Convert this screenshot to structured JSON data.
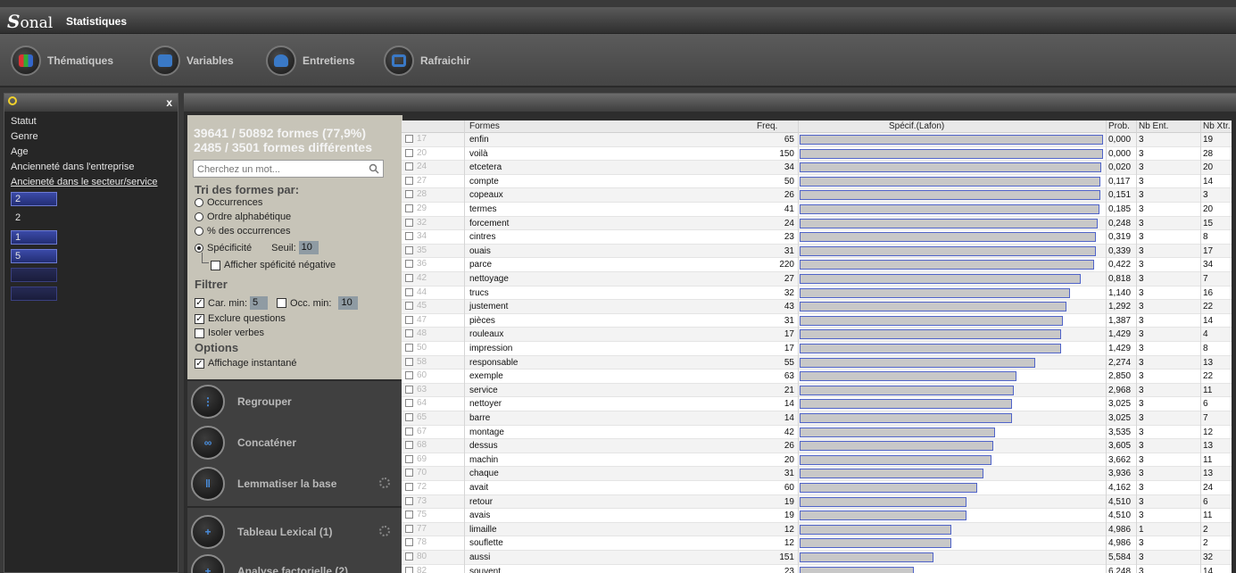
{
  "app": {
    "logo": "Sonal",
    "title": "Statistiques"
  },
  "toolbar": [
    {
      "label": "Thématiques",
      "icon": "grid-icon"
    },
    {
      "label": "Variables",
      "icon": "list-icon"
    },
    {
      "label": "Entretiens",
      "icon": "person-icon"
    },
    {
      "label": "Rafraichir",
      "icon": "refresh-icon"
    }
  ],
  "left_panel": {
    "close": "x",
    "variables": [
      "Statut",
      "Genre",
      "Age",
      "Ancienneté dans l'entreprise",
      "Ancieneté dans le secteur/service"
    ],
    "modalities": [
      "2",
      "2",
      "1",
      "5",
      "",
      ""
    ]
  },
  "stats": {
    "line1": "39641 / 50892 formes (77,9%)",
    "line2": "2485 / 3501 formes différentes"
  },
  "search": {
    "placeholder": "Cherchez un mot..."
  },
  "tri": {
    "title": "Tri des formes par:",
    "options": [
      "Occurrences",
      "Ordre alphabétique",
      "% des occurrences",
      "Spécificité"
    ],
    "selected": 3,
    "seuil_label": "Seuil:",
    "seuil_value": "10",
    "neg_label": "Afficher spéficité négative"
  },
  "filtrer": {
    "title": "Filtrer",
    "car_label": "Car. min:",
    "car_value": "5",
    "occ_label": "Occ. min:",
    "occ_value": "10",
    "exclure": "Exclure questions",
    "isoler": "Isoler verbes"
  },
  "options": {
    "title": "Options",
    "affichage": "Affichage instantané"
  },
  "actions": [
    {
      "label": "Regrouper",
      "glyph": "⋮"
    },
    {
      "label": "Concaténer",
      "glyph": "∞"
    },
    {
      "label": "Lemmatiser la base",
      "glyph": "‖"
    },
    {
      "label": "Tableau Lexical (1)",
      "glyph": "+"
    },
    {
      "label": "Analyse factorielle (2)",
      "glyph": "+"
    }
  ],
  "table": {
    "headers": {
      "formes": "Formes",
      "freq": "Freq.",
      "specif": "Spécif.(Lafon)",
      "prob": "Prob.",
      "nbent": "Nb Ent.",
      "nbxtr": "Nb Xtr."
    },
    "rows": [
      {
        "n": "17",
        "forme": "enfin",
        "freq": "65",
        "specif": 1.0,
        "prob": "0,000",
        "ent": "3",
        "xtr": "19"
      },
      {
        "n": "20",
        "forme": "voilà",
        "freq": "150",
        "specif": 1.0,
        "prob": "0,000",
        "ent": "3",
        "xtr": "28"
      },
      {
        "n": "24",
        "forme": "etcetera",
        "freq": "34",
        "specif": 0.995,
        "prob": "0,020",
        "ent": "3",
        "xtr": "20"
      },
      {
        "n": "27",
        "forme": "compte",
        "freq": "50",
        "specif": 0.99,
        "prob": "0,117",
        "ent": "3",
        "xtr": "14"
      },
      {
        "n": "28",
        "forme": "copeaux",
        "freq": "26",
        "specif": 0.99,
        "prob": "0,151",
        "ent": "3",
        "xtr": "3"
      },
      {
        "n": "29",
        "forme": "termes",
        "freq": "41",
        "specif": 0.987,
        "prob": "0,185",
        "ent": "3",
        "xtr": "20"
      },
      {
        "n": "32",
        "forme": "forcement",
        "freq": "24",
        "specif": 0.982,
        "prob": "0,248",
        "ent": "3",
        "xtr": "15"
      },
      {
        "n": "34",
        "forme": "cintres",
        "freq": "23",
        "specif": 0.976,
        "prob": "0,319",
        "ent": "3",
        "xtr": "8"
      },
      {
        "n": "35",
        "forme": "ouais",
        "freq": "31",
        "specif": 0.976,
        "prob": "0,339",
        "ent": "3",
        "xtr": "17"
      },
      {
        "n": "36",
        "forme": "parce",
        "freq": "220",
        "specif": 0.97,
        "prob": "0,422",
        "ent": "3",
        "xtr": "34"
      },
      {
        "n": "42",
        "forme": "nettoyage",
        "freq": "27",
        "specif": 0.925,
        "prob": "0,818",
        "ent": "3",
        "xtr": "7"
      },
      {
        "n": "44",
        "forme": "trucs",
        "freq": "32",
        "specif": 0.89,
        "prob": "1,140",
        "ent": "3",
        "xtr": "16"
      },
      {
        "n": "45",
        "forme": "justement",
        "freq": "43",
        "specif": 0.878,
        "prob": "1,292",
        "ent": "3",
        "xtr": "22"
      },
      {
        "n": "47",
        "forme": "pièces",
        "freq": "31",
        "specif": 0.868,
        "prob": "1,387",
        "ent": "3",
        "xtr": "14"
      },
      {
        "n": "48",
        "forme": "rouleaux",
        "freq": "17",
        "specif": 0.862,
        "prob": "1,429",
        "ent": "3",
        "xtr": "4"
      },
      {
        "n": "50",
        "forme": "impression",
        "freq": "17",
        "specif": 0.862,
        "prob": "1,429",
        "ent": "3",
        "xtr": "8"
      },
      {
        "n": "58",
        "forme": "responsable",
        "freq": "55",
        "specif": 0.777,
        "prob": "2,274",
        "ent": "3",
        "xtr": "13"
      },
      {
        "n": "60",
        "forme": "exemple",
        "freq": "63",
        "specif": 0.715,
        "prob": "2,850",
        "ent": "3",
        "xtr": "22"
      },
      {
        "n": "63",
        "forme": "service",
        "freq": "21",
        "specif": 0.705,
        "prob": "2,968",
        "ent": "3",
        "xtr": "11"
      },
      {
        "n": "64",
        "forme": "nettoyer",
        "freq": "14",
        "specif": 0.7,
        "prob": "3,025",
        "ent": "3",
        "xtr": "6"
      },
      {
        "n": "65",
        "forme": "barre",
        "freq": "14",
        "specif": 0.7,
        "prob": "3,025",
        "ent": "3",
        "xtr": "7"
      },
      {
        "n": "67",
        "forme": "montage",
        "freq": "42",
        "specif": 0.645,
        "prob": "3,535",
        "ent": "3",
        "xtr": "12"
      },
      {
        "n": "68",
        "forme": "dessus",
        "freq": "26",
        "specif": 0.637,
        "prob": "3,605",
        "ent": "3",
        "xtr": "13"
      },
      {
        "n": "69",
        "forme": "machin",
        "freq": "20",
        "specif": 0.632,
        "prob": "3,662",
        "ent": "3",
        "xtr": "11"
      },
      {
        "n": "70",
        "forme": "chaque",
        "freq": "31",
        "specif": 0.605,
        "prob": "3,936",
        "ent": "3",
        "xtr": "13"
      },
      {
        "n": "72",
        "forme": "avait",
        "freq": "60",
        "specif": 0.584,
        "prob": "4,162",
        "ent": "3",
        "xtr": "24"
      },
      {
        "n": "73",
        "forme": "retour",
        "freq": "19",
        "specif": 0.55,
        "prob": "4,510",
        "ent": "3",
        "xtr": "6"
      },
      {
        "n": "75",
        "forme": "avais",
        "freq": "19",
        "specif": 0.55,
        "prob": "4,510",
        "ent": "3",
        "xtr": "11"
      },
      {
        "n": "77",
        "forme": "limaille",
        "freq": "12",
        "specif": 0.5,
        "prob": "4,986",
        "ent": "1",
        "xtr": "2"
      },
      {
        "n": "78",
        "forme": "souflette",
        "freq": "12",
        "specif": 0.5,
        "prob": "4,986",
        "ent": "3",
        "xtr": "2"
      },
      {
        "n": "80",
        "forme": "aussi",
        "freq": "151",
        "specif": 0.44,
        "prob": "5,584",
        "ent": "3",
        "xtr": "32"
      },
      {
        "n": "82",
        "forme": "souvent",
        "freq": "23",
        "specif": 0.375,
        "prob": "6,248",
        "ent": "3",
        "xtr": "14"
      }
    ]
  }
}
